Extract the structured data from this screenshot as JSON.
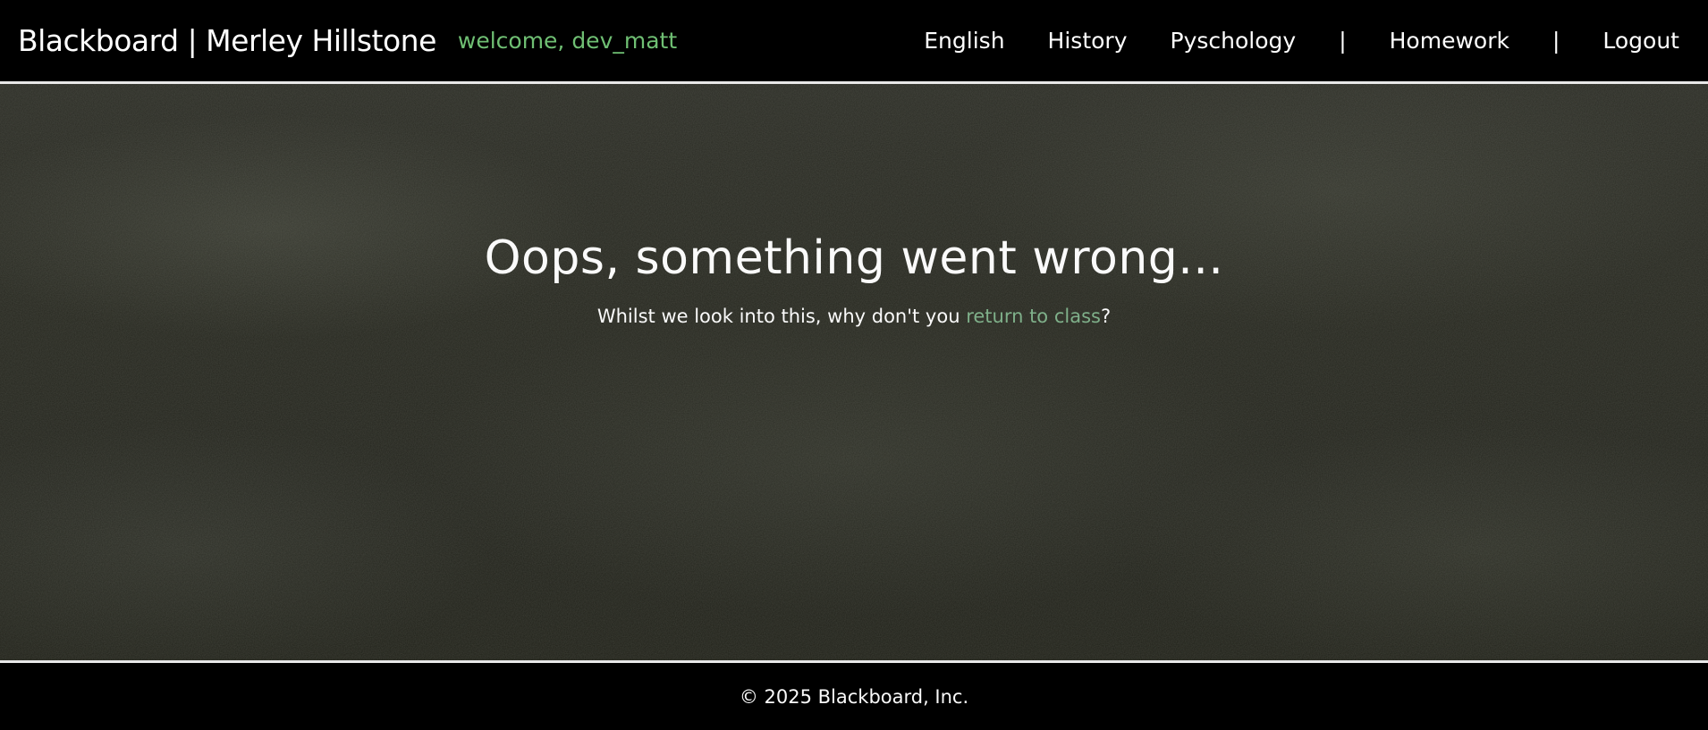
{
  "header": {
    "brand": "Blackboard | Merley Hillstone",
    "welcome": "welcome, dev_matt",
    "nav": {
      "english": "English",
      "history": "History",
      "psychology": "Pyschology",
      "separator": "|",
      "homework": "Homework",
      "logout": "Logout"
    }
  },
  "main": {
    "title": "Oops, something went wrong...",
    "subtitle_prefix": "Whilst we look into this, why don't you ",
    "subtitle_link": "return to class",
    "subtitle_suffix": "?"
  },
  "footer": {
    "copyright": "© 2025 Blackboard, Inc."
  },
  "colors": {
    "accent_green": "#6fbf73",
    "link_green": "#7fb08a",
    "background": "#000000",
    "chalkboard": "#26271f"
  }
}
